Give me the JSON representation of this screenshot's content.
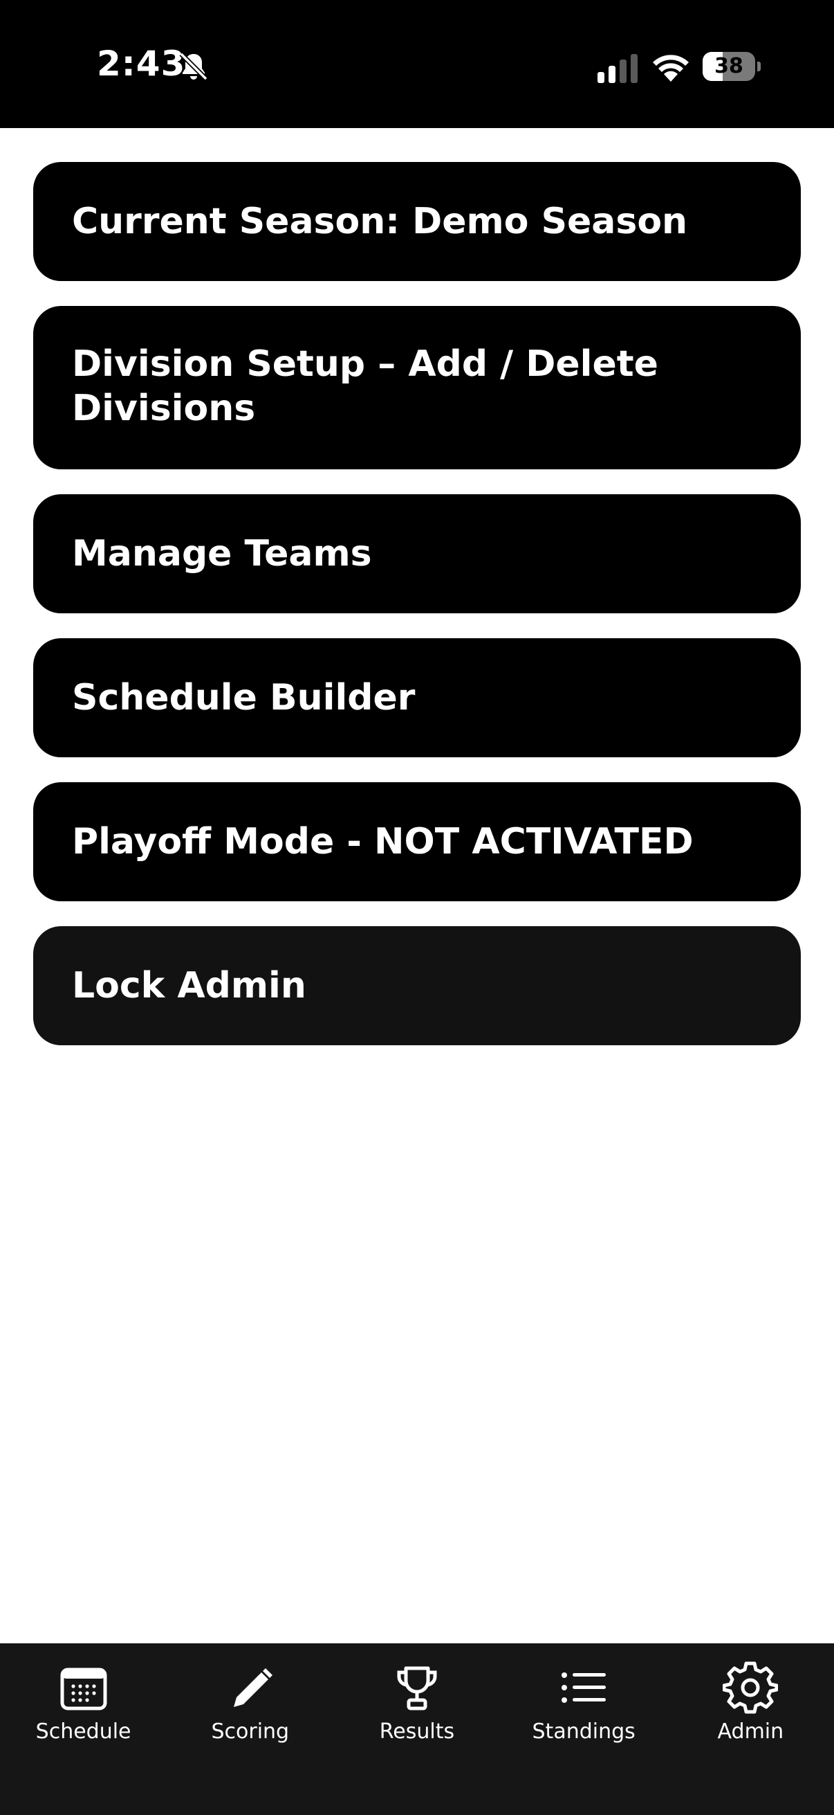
{
  "status_bar": {
    "time": "2:43",
    "battery_level": "38",
    "battery_fraction": 0.38,
    "icons": [
      "bell-slash-icon",
      "cellular-signal-icon",
      "wifi-icon",
      "battery-icon"
    ]
  },
  "menu": {
    "items": [
      {
        "label": "Current Season: Demo Season"
      },
      {
        "label": "Division Setup – Add / Delete Divisions"
      },
      {
        "label": "Manage Teams"
      },
      {
        "label": "Schedule Builder"
      },
      {
        "label": "Playoff Mode - NOT ACTIVATED"
      },
      {
        "label": "Lock Admin"
      }
    ]
  },
  "tab_bar": {
    "tabs": [
      {
        "label": "Schedule",
        "icon": "calendar-icon"
      },
      {
        "label": "Scoring",
        "icon": "pencil-icon"
      },
      {
        "label": "Results",
        "icon": "trophy-icon"
      },
      {
        "label": "Standings",
        "icon": "list-icon"
      },
      {
        "label": "Admin",
        "icon": "gear-icon"
      }
    ],
    "selected": "Admin"
  },
  "colors": {
    "status_bar_bg": "#000000",
    "button_bg": "#000000",
    "lock_button_bg": "#121212",
    "tab_bar_bg": "#161616",
    "text": "#ffffff"
  }
}
